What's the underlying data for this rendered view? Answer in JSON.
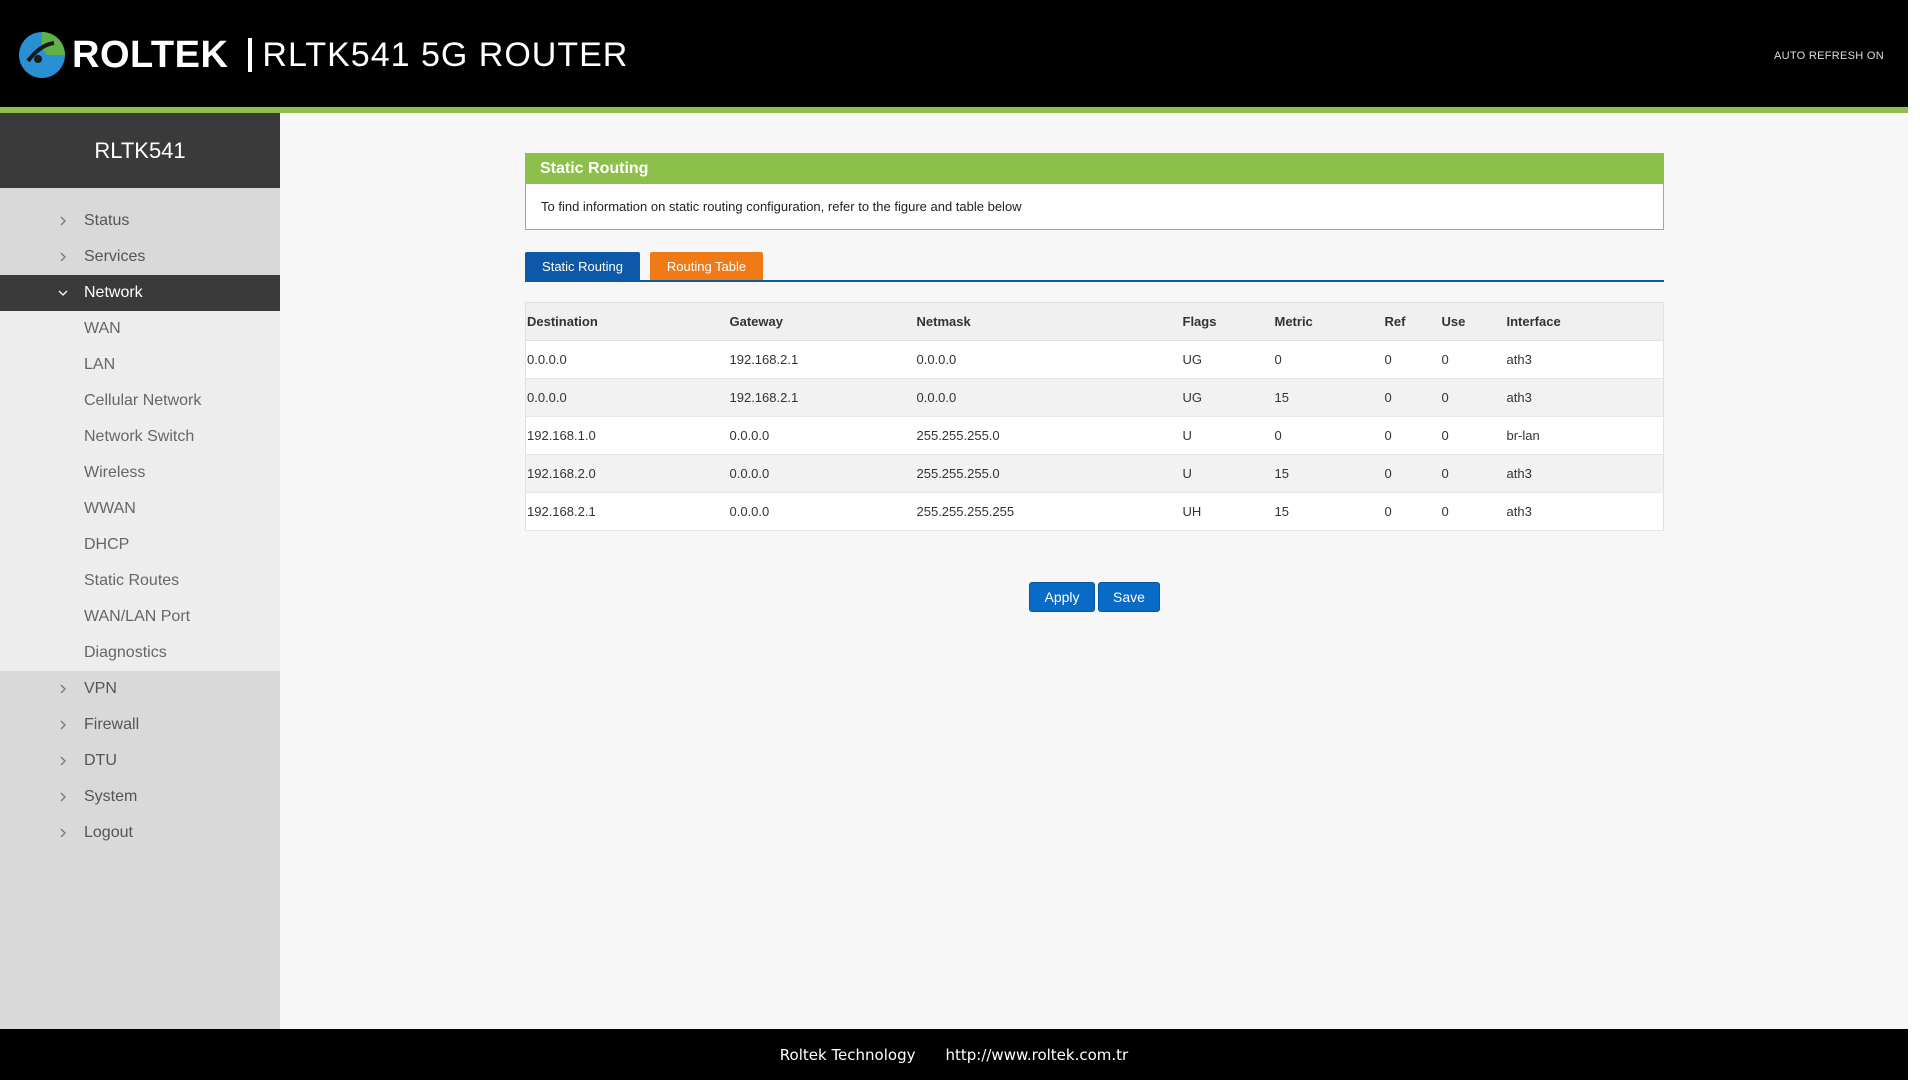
{
  "header": {
    "brand": "ROLTEK",
    "model_title": "RLTK541  5G  ROUTER",
    "auto_refresh": "AUTO REFRESH ON"
  },
  "sidebar": {
    "device_name": "RLTK541",
    "items": [
      {
        "label": "Status"
      },
      {
        "label": "Services"
      },
      {
        "label": "Network"
      },
      {
        "label": "VPN"
      },
      {
        "label": "Firewall"
      },
      {
        "label": "DTU"
      },
      {
        "label": "System"
      },
      {
        "label": "Logout"
      }
    ],
    "network_sub": [
      {
        "label": "WAN"
      },
      {
        "label": "LAN"
      },
      {
        "label": "Cellular Network"
      },
      {
        "label": "Network Switch"
      },
      {
        "label": "Wireless"
      },
      {
        "label": "WWAN"
      },
      {
        "label": "DHCP"
      },
      {
        "label": "Static Routes"
      },
      {
        "label": "WAN/LAN Port"
      },
      {
        "label": "Diagnostics"
      }
    ]
  },
  "panel": {
    "title": "Static Routing",
    "description": "To find information on static routing configuration, refer to the figure and table below"
  },
  "tabs": {
    "static_routing": "Static Routing",
    "routing_table": "Routing Table"
  },
  "table": {
    "headers": [
      "Destination",
      "Gateway",
      "Netmask",
      "Flags",
      "Metric",
      "Ref",
      "Use",
      "Interface"
    ],
    "rows": [
      [
        "0.0.0.0",
        "192.168.2.1",
        "0.0.0.0",
        "UG",
        "0",
        "0",
        "0",
        "ath3"
      ],
      [
        "0.0.0.0",
        "192.168.2.1",
        "0.0.0.0",
        "UG",
        "15",
        "0",
        "0",
        "ath3"
      ],
      [
        "192.168.1.0",
        "0.0.0.0",
        "255.255.255.0",
        "U",
        "0",
        "0",
        "0",
        "br-lan"
      ],
      [
        "192.168.2.0",
        "0.0.0.0",
        "255.255.255.0",
        "U",
        "15",
        "0",
        "0",
        "ath3"
      ],
      [
        "192.168.2.1",
        "0.0.0.0",
        "255.255.255.255",
        "UH",
        "15",
        "0",
        "0",
        "ath3"
      ]
    ]
  },
  "buttons": {
    "apply": "Apply",
    "save": "Save"
  },
  "footer": {
    "company": "Roltek Technology",
    "url": "http://www.roltek.com.tr"
  },
  "colors": {
    "accent_green": "#8cc04b",
    "tab_blue": "#0d59a8",
    "tab_orange": "#f07a16",
    "button_blue": "#0a6bc7"
  }
}
